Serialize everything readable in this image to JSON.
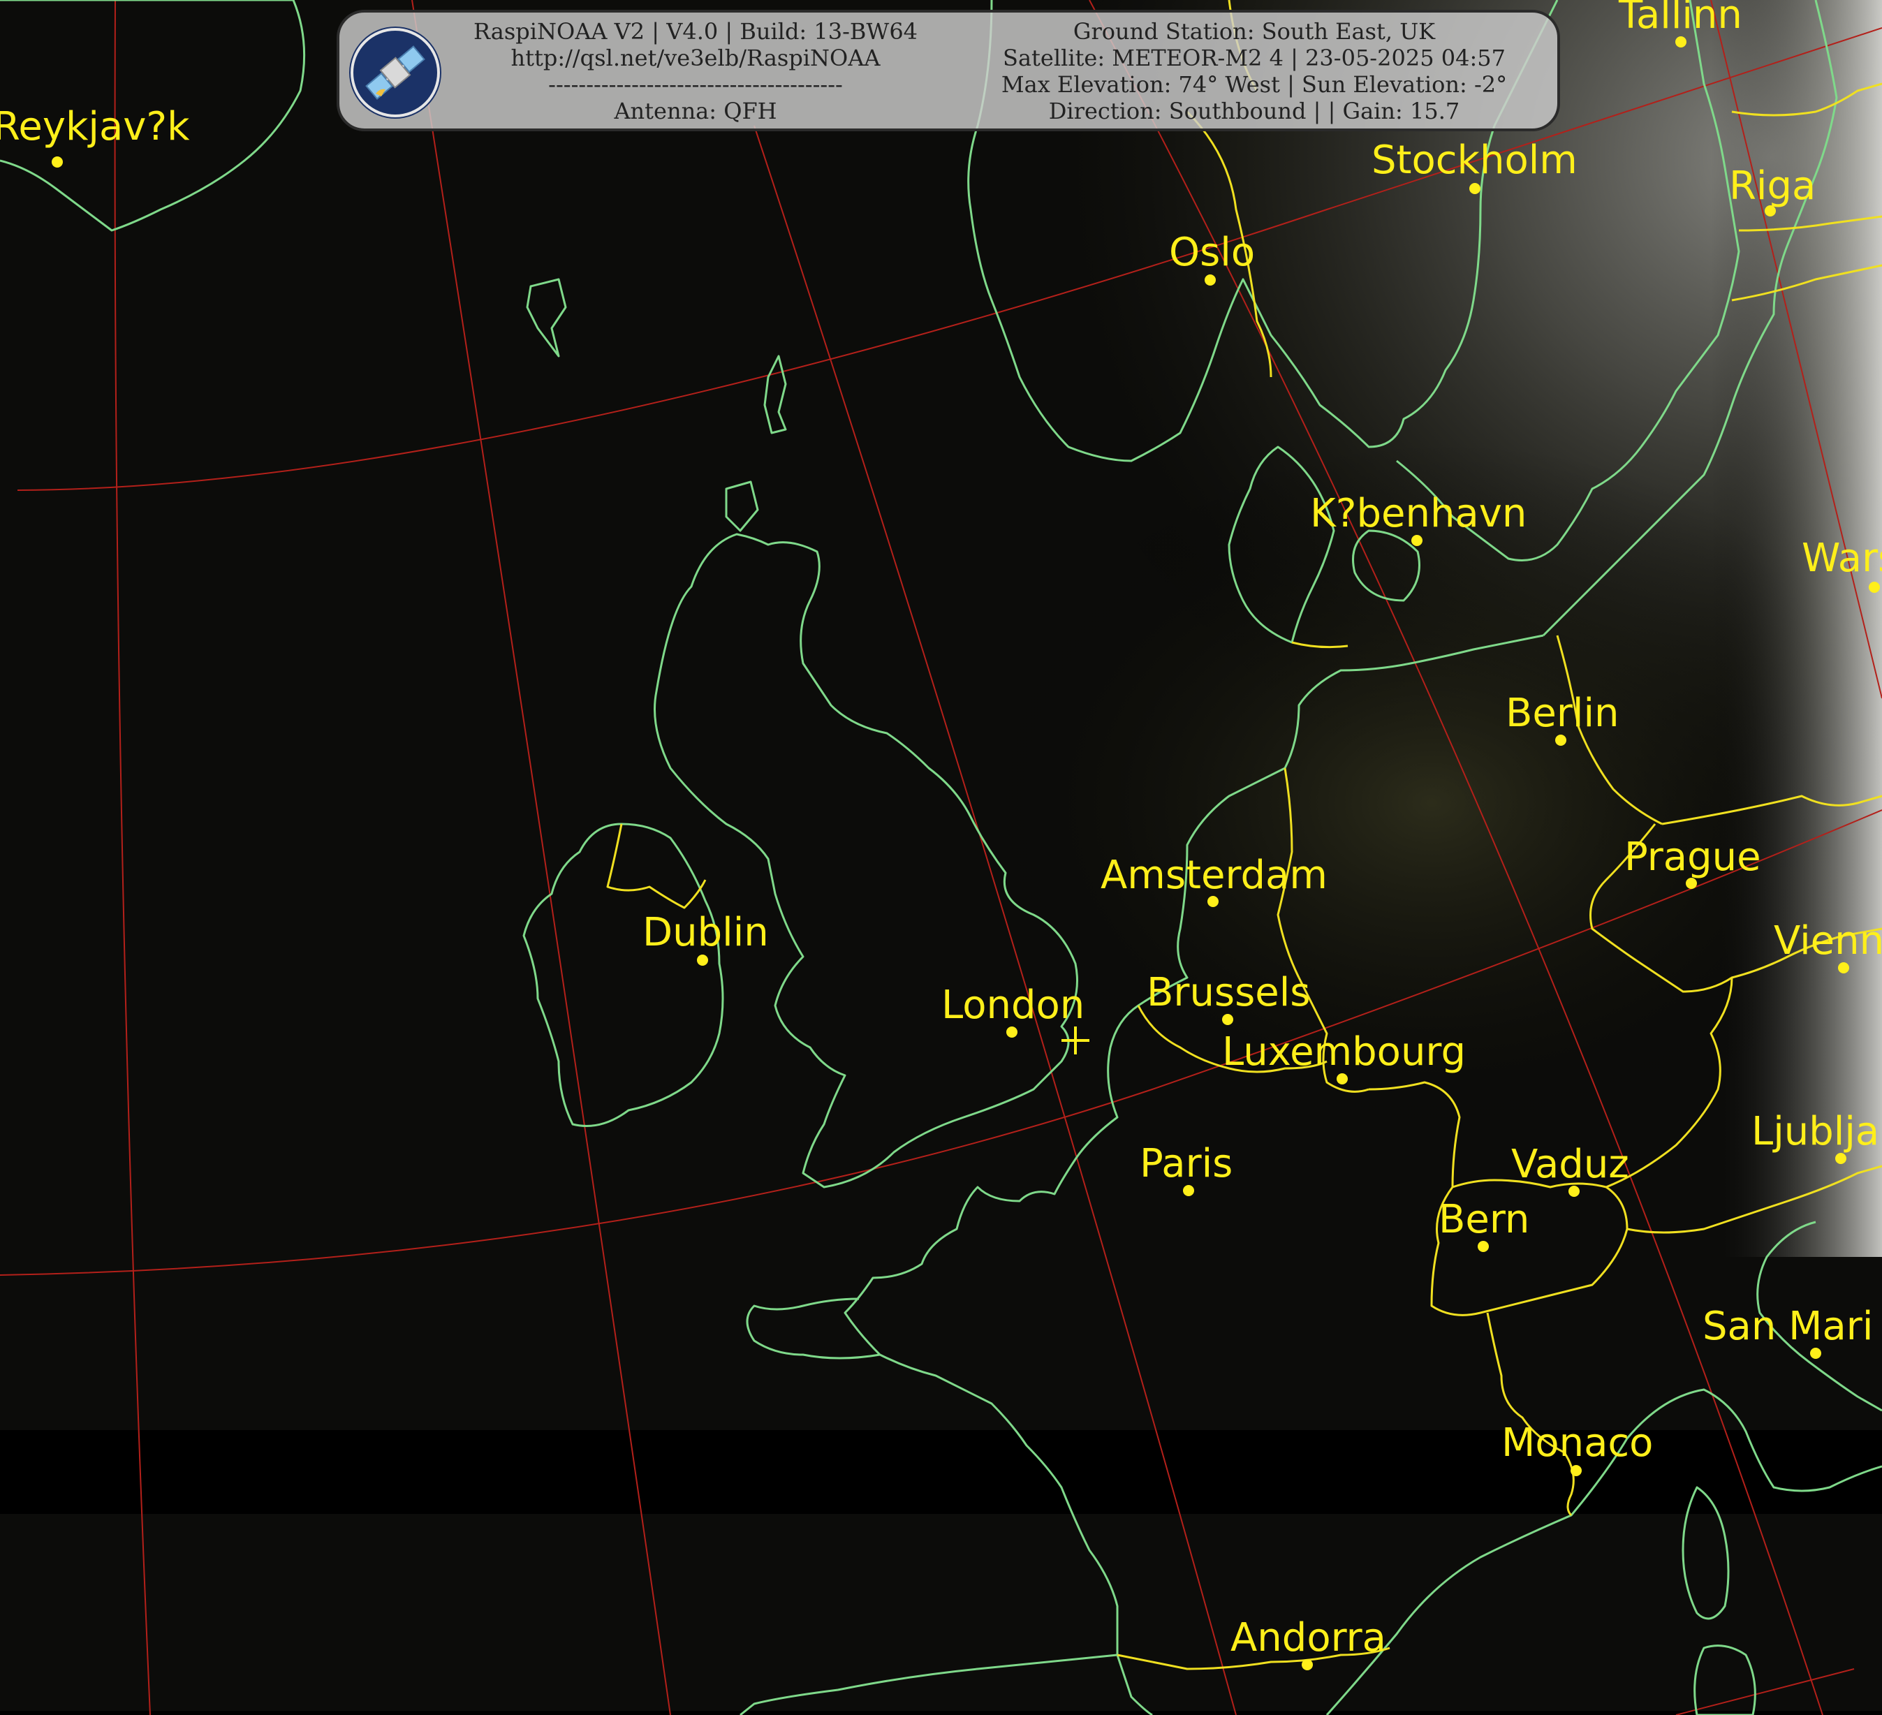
{
  "header": {
    "left_lines": [
      "RaspiNOAA V2 | V4.0 | Build: 13-BW64",
      "http://qsl.net/ve3elb/RaspiNOAA",
      "---------------------------------------",
      "Antenna: QFH"
    ],
    "right_lines": [
      "Ground Station: South East, UK",
      "Satellite: METEOR-M2 4 | 23-05-2025 04:57",
      "Max Elevation: 74° West | Sun Elevation: -2°",
      "Direction: Southbound | | Gain: 15.7"
    ],
    "logo_icon": "satellite-icon"
  },
  "cities": [
    {
      "name": "Reykjav?k"
    },
    {
      "name": "Tallinn"
    },
    {
      "name": "Stockholm"
    },
    {
      "name": "Riga"
    },
    {
      "name": "Oslo"
    },
    {
      "name": "K?benhavn"
    },
    {
      "name": "Wars"
    },
    {
      "name": "Berlin"
    },
    {
      "name": "Prague"
    },
    {
      "name": "Amsterdam"
    },
    {
      "name": "Dublin"
    },
    {
      "name": "London"
    },
    {
      "name": "Brussels"
    },
    {
      "name": "Luxembourg"
    },
    {
      "name": "Vienn"
    },
    {
      "name": "Paris"
    },
    {
      "name": "Vaduz"
    },
    {
      "name": "Ljublja"
    },
    {
      "name": "Bern"
    },
    {
      "name": "San Mari"
    },
    {
      "name": "Monaco"
    },
    {
      "name": "Andorra"
    }
  ],
  "colors": {
    "coastline": "#7fd98a",
    "border": "#f0e020",
    "graticule": "#b3201a",
    "labels": "#ffef1a"
  }
}
